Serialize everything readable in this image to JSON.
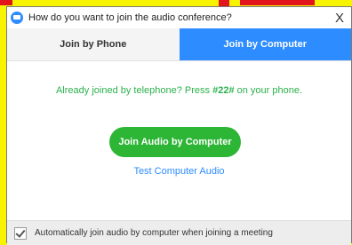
{
  "window": {
    "title": "How do you want to join the audio conference?",
    "close_glyph": "X"
  },
  "tabs": [
    {
      "label": "Join by Phone",
      "active": false
    },
    {
      "label": "Join by Computer",
      "active": true
    }
  ],
  "main": {
    "info_prefix": "Already joined by telephone? Press ",
    "info_code": "#22#",
    "info_suffix": " on your phone.",
    "join_button_label": "Join Audio by Computer",
    "test_link_label": "Test Computer Audio"
  },
  "footer": {
    "auto_join_checked": true,
    "auto_join_label": "Automatically join audio by computer when joining a meeting"
  },
  "colors": {
    "background": "#f8f400",
    "accent_blue": "#2d8cff",
    "green_button": "#2db535",
    "green_text": "#2bb14c",
    "red_marks": "#e2141c"
  },
  "icons": {
    "app": "zoom-camera-icon",
    "close": "close-icon",
    "check": "check-icon"
  }
}
